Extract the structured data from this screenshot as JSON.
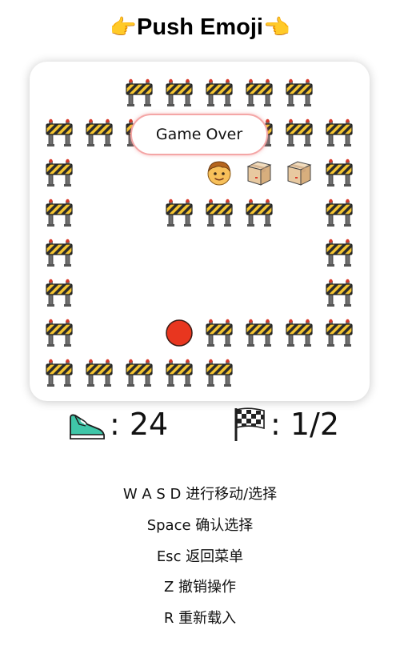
{
  "title": "Push Emoji",
  "title_icons": [
    "pointing-right-icon",
    "pointing-left-icon"
  ],
  "board": {
    "rows": 8,
    "cols": 8,
    "walls": [
      [
        0,
        2
      ],
      [
        0,
        3
      ],
      [
        0,
        4
      ],
      [
        0,
        5
      ],
      [
        0,
        6
      ],
      [
        1,
        0
      ],
      [
        1,
        1
      ],
      [
        1,
        2
      ],
      [
        1,
        5
      ],
      [
        1,
        6
      ],
      [
        1,
        7
      ],
      [
        2,
        0
      ],
      [
        2,
        7
      ],
      [
        3,
        0
      ],
      [
        3,
        3
      ],
      [
        3,
        4
      ],
      [
        3,
        5
      ],
      [
        3,
        7
      ],
      [
        4,
        0
      ],
      [
        4,
        7
      ],
      [
        5,
        0
      ],
      [
        5,
        7
      ],
      [
        6,
        0
      ],
      [
        6,
        4
      ],
      [
        6,
        5
      ],
      [
        6,
        6
      ],
      [
        6,
        7
      ],
      [
        7,
        0
      ],
      [
        7,
        1
      ],
      [
        7,
        2
      ],
      [
        7,
        3
      ],
      [
        7,
        4
      ]
    ],
    "player": [
      2,
      4
    ],
    "boxes": [
      [
        2,
        5
      ],
      [
        2,
        6
      ]
    ],
    "targets": [
      [
        6,
        3
      ]
    ],
    "wall_icon": "construction-barrier-icon",
    "player_icon": "boy-face-icon",
    "box_icon": "package-icon",
    "target_icon": "red-circle-icon"
  },
  "overlay": {
    "text": "Game Over"
  },
  "stats": {
    "steps_icon": "running-shoe-icon",
    "steps": ": 24",
    "level_icon": "checkered-flag-icon",
    "level": ": 1/2"
  },
  "help": [
    "W A S D 进行移动/选择",
    "Space 确认选择",
    "Esc 返回菜单",
    "Z 撤销操作",
    "R 重新载入"
  ],
  "colors": {
    "stripe_yellow": "#F4C430",
    "stripe_dark": "#2B2B2B",
    "leg_gray": "#6E6E6E",
    "lamp_red": "#D93A2B",
    "box_tan": "#E8C9A0",
    "target_red": "#E8361F",
    "overlay_border": "#F4A6A6"
  }
}
